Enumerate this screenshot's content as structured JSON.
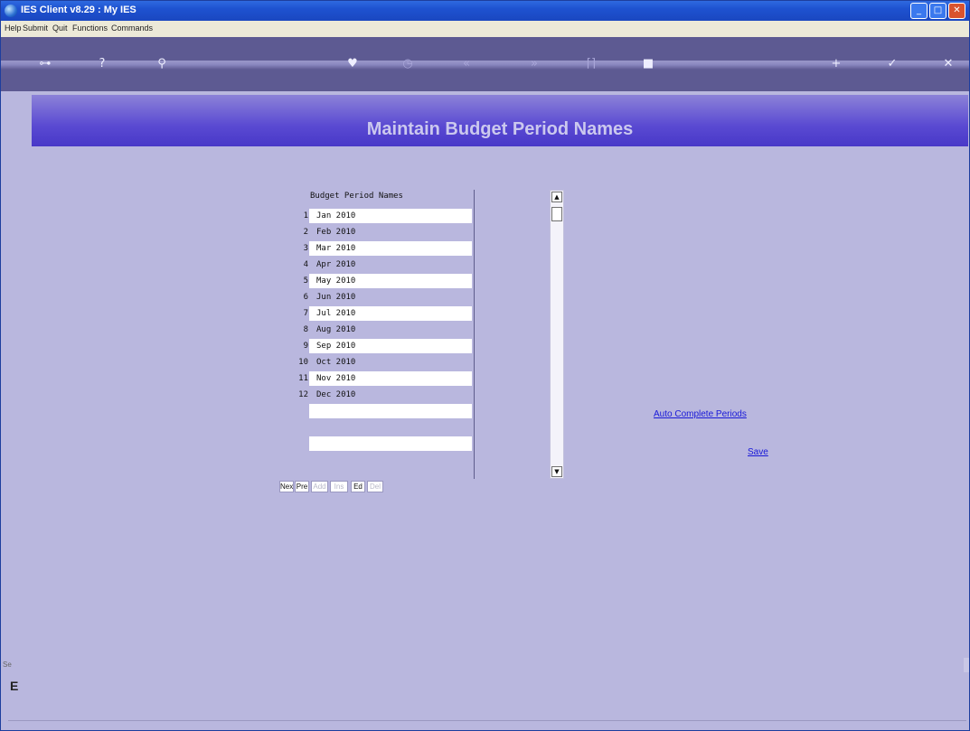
{
  "window": {
    "title": "IES Client v8.29 : My IES",
    "controls": {
      "minimize": "_",
      "maximize": "□",
      "close": "✕"
    }
  },
  "menu": {
    "items": [
      "Help",
      "Submit",
      "Quit",
      "Functions",
      "Commands"
    ]
  },
  "toolbar": {
    "icons": [
      {
        "name": "key-icon",
        "glyph": "⊶"
      },
      {
        "name": "help-icon",
        "glyph": "?"
      },
      {
        "name": "search-icon",
        "glyph": "⚲"
      },
      {
        "name": "heart-icon",
        "glyph": "♥"
      },
      {
        "name": "clock-icon",
        "glyph": "◷"
      },
      {
        "name": "rewind-icon",
        "glyph": "«"
      },
      {
        "name": "forward-icon",
        "glyph": "»"
      },
      {
        "name": "bookmark-icon",
        "glyph": "⌈⌉"
      },
      {
        "name": "stop-icon",
        "glyph": "■"
      },
      {
        "name": "plus-icon",
        "glyph": "+"
      },
      {
        "name": "check-icon",
        "glyph": "✓"
      },
      {
        "name": "close-icon",
        "glyph": "✕"
      }
    ]
  },
  "header": {
    "title": "Maintain Budget Period Names"
  },
  "grid": {
    "column_header": "Budget Period Names",
    "rows": [
      {
        "num": "1",
        "value": "Jan 2010"
      },
      {
        "num": "2",
        "value": "Feb 2010"
      },
      {
        "num": "3",
        "value": "Mar 2010"
      },
      {
        "num": "4",
        "value": "Apr 2010"
      },
      {
        "num": "5",
        "value": "May 2010"
      },
      {
        "num": "6",
        "value": "Jun 2010"
      },
      {
        "num": "7",
        "value": "Jul 2010"
      },
      {
        "num": "8",
        "value": "Aug 2010"
      },
      {
        "num": "9",
        "value": "Sep 2010"
      },
      {
        "num": "10",
        "value": "Oct 2010"
      },
      {
        "num": "11",
        "value": "Nov 2010"
      },
      {
        "num": "12",
        "value": "Dec 2010"
      },
      {
        "num": "",
        "value": ""
      },
      {
        "num": "",
        "value": ""
      },
      {
        "num": "",
        "value": ""
      },
      {
        "num": "",
        "value": ""
      }
    ],
    "buttons": [
      {
        "label": "Nex",
        "enabled": true
      },
      {
        "label": "Pre",
        "enabled": true
      },
      {
        "label": "Add",
        "enabled": false
      },
      {
        "label": "Ins",
        "enabled": false
      },
      {
        "label": "Ed",
        "enabled": true
      },
      {
        "label": "Del",
        "enabled": false
      }
    ]
  },
  "scrollbar": {
    "up": "▲",
    "down": "▼"
  },
  "actions": {
    "auto_complete": "Auto Complete Periods",
    "save": "Save"
  },
  "sidepanel": {
    "label": "Se",
    "glyph": "E"
  }
}
